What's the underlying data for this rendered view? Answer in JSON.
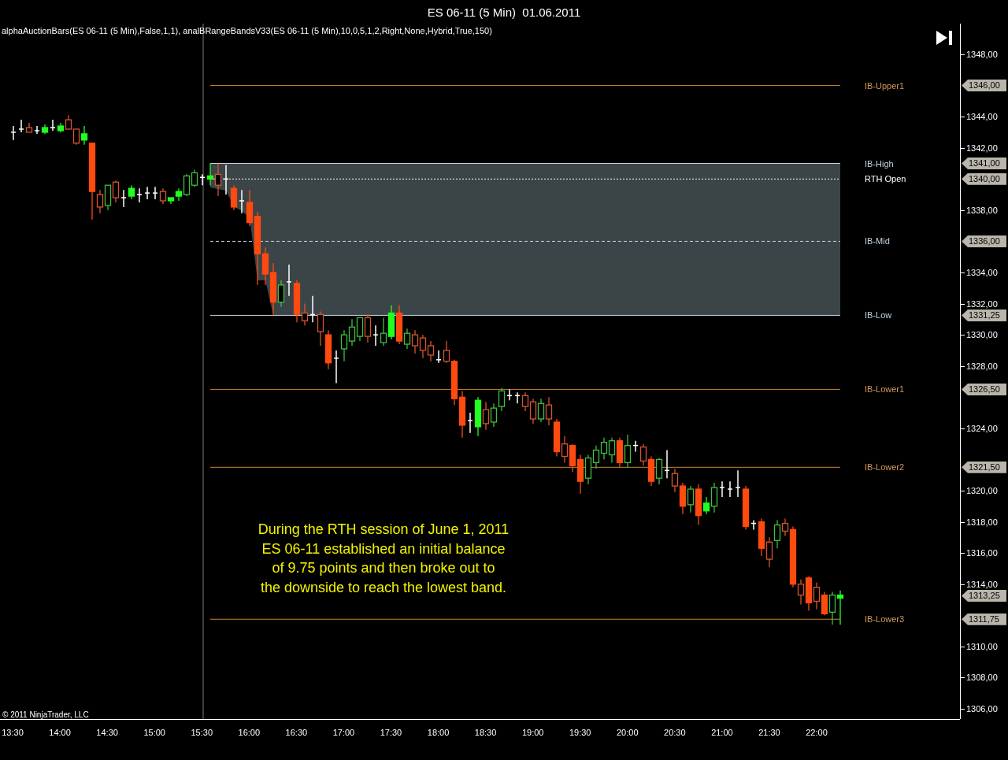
{
  "window": {
    "title": "ES 06-11 (5 Min)  01.06.2011"
  },
  "chart": {
    "indicators": "alphaAuctionBars(ES 06-11 (5 Min),False,1,1), analBRangeBandsV33(ES 06-11 (5 Min),10,0,5,1,2,Right,None,Hybrid,True,150)",
    "bands": [
      {
        "label": "IB-Upper1",
        "tag": "1346,00",
        "color": "#d39a5c",
        "kind": "solid"
      },
      {
        "label": "IB-High",
        "tag": "1341,00",
        "color": "#c4d4e2",
        "kind": "solid"
      },
      {
        "label": "RTH Open",
        "tag": "1340,00",
        "color": "#ffffff",
        "kind": "dotted"
      },
      {
        "label": "IB-Mid",
        "tag": "1336,00",
        "color": "#c4d4e2",
        "kind": "dashed"
      },
      {
        "label": "IB-Low",
        "tag": "1331,25",
        "color": "#c4d4e2",
        "kind": "solid"
      },
      {
        "label": "IB-Lower1",
        "tag": "1326,50",
        "color": "#d39a5c",
        "kind": "solid"
      },
      {
        "label": "IB-Lower2",
        "tag": "1321,50",
        "color": "#d39a5c",
        "kind": "solid"
      },
      {
        "label": "IB-Lower3",
        "tag": "1311,75",
        "color": "#d39a5c",
        "kind": "solid"
      }
    ],
    "last_price": {
      "tag": "1313,25"
    },
    "annotation": [
      "During the RTH session of June 1, 2011",
      "ES 06-11 established an initial balance",
      "of 9.75 points and then broke out to",
      "the downside to reach the lowest band."
    ],
    "copyright": "© 2011 NinjaTrader, LLC",
    "price_axis": [
      "1348,00",
      "1344,00",
      "1342,00",
      "1338,00",
      "1334,00",
      "1332,00",
      "1330,00",
      "1328,00",
      "1324,00",
      "1320,00",
      "1318,00",
      "1316,00",
      "1314,00",
      "1310,00",
      "1308,00",
      "1306,00"
    ],
    "time_axis": [
      "13:30",
      "14:00",
      "14:30",
      "15:00",
      "15:30",
      "16:00",
      "16:30",
      "17:00",
      "17:30",
      "18:00",
      "18:30",
      "19:00",
      "19:30",
      "20:00",
      "20:30",
      "21:00",
      "21:30",
      "22:00"
    ]
  }
}
